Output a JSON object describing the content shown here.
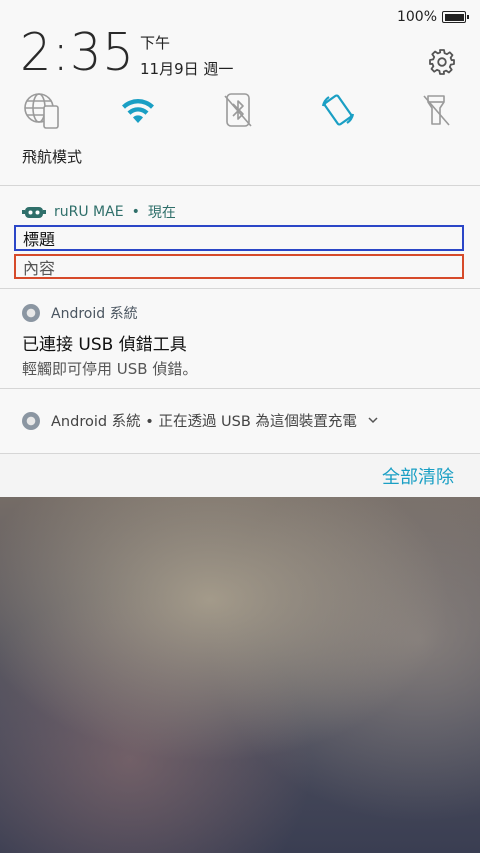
{
  "status_bar": {
    "battery_percent": "100%",
    "battery_level": 1.0
  },
  "clock": {
    "time": "2:35",
    "ampm": "下午",
    "date": "11月9日 週一"
  },
  "quick_settings": {
    "tiles": [
      {
        "icon": "globe-phone-icon",
        "active": false
      },
      {
        "icon": "wifi-icon",
        "active": true
      },
      {
        "icon": "bluetooth-off-icon",
        "active": false
      },
      {
        "icon": "auto-rotate-icon",
        "active": true
      },
      {
        "icon": "flashlight-off-icon",
        "active": false
      }
    ],
    "label": "飛航模式",
    "accent_color": "#1a9fc4"
  },
  "notifications": [
    {
      "app": "ruRU MAE",
      "time": "現在",
      "title": "標題",
      "content": "內容"
    },
    {
      "app": "Android 系統",
      "title": "已連接 USB 偵錯工具",
      "text": "輕觸即可停用 USB 偵錯。"
    },
    {
      "app": "Android 系統",
      "summary": "正在透過 USB 為這個裝置充電"
    }
  ],
  "actions": {
    "clear_all": "全部清除"
  },
  "app_row_separator": "•"
}
